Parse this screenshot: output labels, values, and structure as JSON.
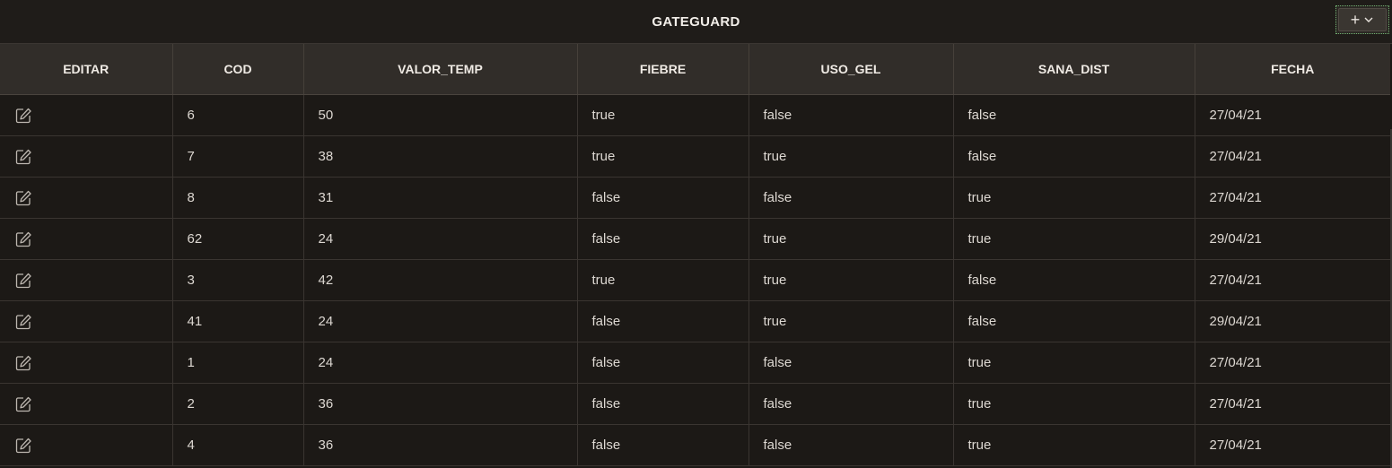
{
  "header": {
    "title": "GATEGUARD",
    "add_button_icon": "plus-icon",
    "menu_icon": "chevron-down-icon"
  },
  "table": {
    "columns": [
      "EDITAR",
      "COD",
      "VALOR_TEMP",
      "FIEBRE",
      "USO_GEL",
      "SANA_DIST",
      "FECHA"
    ],
    "edit_icon": "edit-icon",
    "rows": [
      {
        "cod": "6",
        "valor_temp": "50",
        "fiebre": "true",
        "uso_gel": "false",
        "sana_dist": "false",
        "fecha": "27/04/21"
      },
      {
        "cod": "7",
        "valor_temp": "38",
        "fiebre": "true",
        "uso_gel": "true",
        "sana_dist": "false",
        "fecha": "27/04/21"
      },
      {
        "cod": "8",
        "valor_temp": "31",
        "fiebre": "false",
        "uso_gel": "false",
        "sana_dist": "true",
        "fecha": "27/04/21"
      },
      {
        "cod": "62",
        "valor_temp": "24",
        "fiebre": "false",
        "uso_gel": "true",
        "sana_dist": "true",
        "fecha": "29/04/21"
      },
      {
        "cod": "3",
        "valor_temp": "42",
        "fiebre": "true",
        "uso_gel": "true",
        "sana_dist": "false",
        "fecha": "27/04/21"
      },
      {
        "cod": "41",
        "valor_temp": "24",
        "fiebre": "false",
        "uso_gel": "true",
        "sana_dist": "false",
        "fecha": "29/04/21"
      },
      {
        "cod": "1",
        "valor_temp": "24",
        "fiebre": "false",
        "uso_gel": "false",
        "sana_dist": "true",
        "fecha": "27/04/21"
      },
      {
        "cod": "2",
        "valor_temp": "36",
        "fiebre": "false",
        "uso_gel": "false",
        "sana_dist": "true",
        "fecha": "27/04/21"
      },
      {
        "cod": "4",
        "valor_temp": "36",
        "fiebre": "false",
        "uso_gel": "false",
        "sana_dist": "true",
        "fecha": "27/04/21"
      }
    ]
  },
  "colors": {
    "background": "#1c1916",
    "header_row": "#312d29",
    "accent_focus": "#6fae6f"
  }
}
